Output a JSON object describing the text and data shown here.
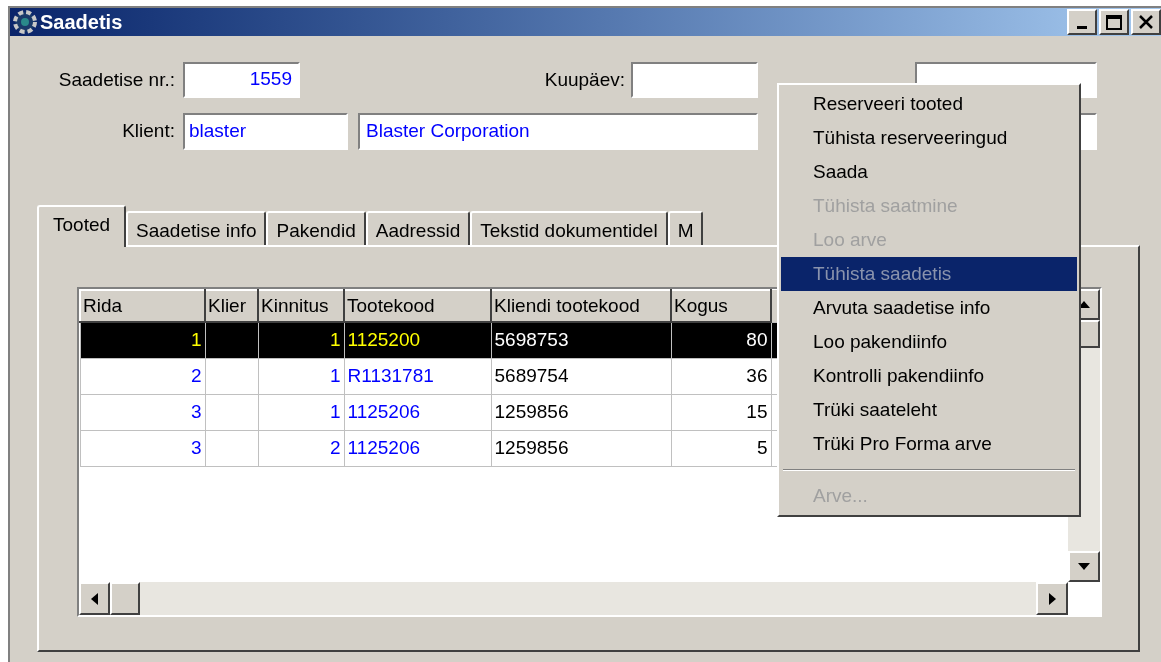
{
  "window": {
    "title": "Saadetis"
  },
  "form": {
    "number_label": "Saadetise nr.:",
    "number": "1559",
    "date_label": "Kuupäev:",
    "client_label": "Klient:",
    "client_code": "blaster",
    "client_name": "Blaster Corporation"
  },
  "tabs": [
    {
      "label": "Tooted",
      "selected": true
    },
    {
      "label": "Saadetise info",
      "selected": false
    },
    {
      "label": "Pakendid",
      "selected": false
    },
    {
      "label": "Aadressid",
      "selected": false
    },
    {
      "label": "Tekstid dokumentidel",
      "selected": false
    },
    {
      "label": "M",
      "selected": false
    }
  ],
  "table": {
    "columns": [
      {
        "label": "Rida",
        "kind": "number",
        "highlight": true
      },
      {
        "label": "Klier",
        "kind": "text"
      },
      {
        "label": "Kinnitus",
        "kind": "number",
        "highlight": true
      },
      {
        "label": "Tootekood",
        "kind": "text",
        "highlight": true
      },
      {
        "label": "Kliendi tootekood",
        "kind": "text",
        "highlight": false
      },
      {
        "label": "Kogus",
        "kind": "number",
        "highlight": false
      }
    ],
    "rows": [
      {
        "selected": true,
        "cells": [
          "1",
          null,
          "1",
          "1125200",
          "5698753",
          "80"
        ]
      },
      {
        "selected": false,
        "cells": [
          "2",
          null,
          "1",
          "R1131781",
          "5689754",
          "36"
        ]
      },
      {
        "selected": false,
        "cells": [
          "3",
          null,
          "1",
          "1125206",
          "1259856",
          "15"
        ]
      },
      {
        "selected": false,
        "cells": [
          "3",
          null,
          "2",
          "1125206",
          "1259856",
          "5"
        ]
      }
    ]
  },
  "context_menu": [
    {
      "kind": "item",
      "label": "Reserveeri tooted",
      "disabled": false,
      "selected": false
    },
    {
      "kind": "item",
      "label": "Tühista reserveeringud",
      "disabled": false,
      "selected": false
    },
    {
      "kind": "item",
      "label": "Saada",
      "disabled": false,
      "selected": false
    },
    {
      "kind": "item",
      "label": "Tühista saatmine",
      "disabled": true,
      "selected": false
    },
    {
      "kind": "item",
      "label": "Loo arve",
      "disabled": true,
      "selected": false
    },
    {
      "kind": "item",
      "label": "Tühista saadetis",
      "disabled": true,
      "selected": true
    },
    {
      "kind": "item",
      "label": "Arvuta saadetise info",
      "disabled": false,
      "selected": false
    },
    {
      "kind": "item",
      "label": "Loo pakendiinfo",
      "disabled": false,
      "selected": false
    },
    {
      "kind": "item",
      "label": "Kontrolli pakendiinfo",
      "disabled": false,
      "selected": false
    },
    {
      "kind": "item",
      "label": "Trüki saateleht",
      "disabled": false,
      "selected": false
    },
    {
      "kind": "item",
      "label": "Trüki Pro Forma arve",
      "disabled": false,
      "selected": false
    },
    {
      "kind": "separator"
    },
    {
      "kind": "item",
      "label": "Arve...",
      "disabled": true,
      "selected": false
    }
  ]
}
